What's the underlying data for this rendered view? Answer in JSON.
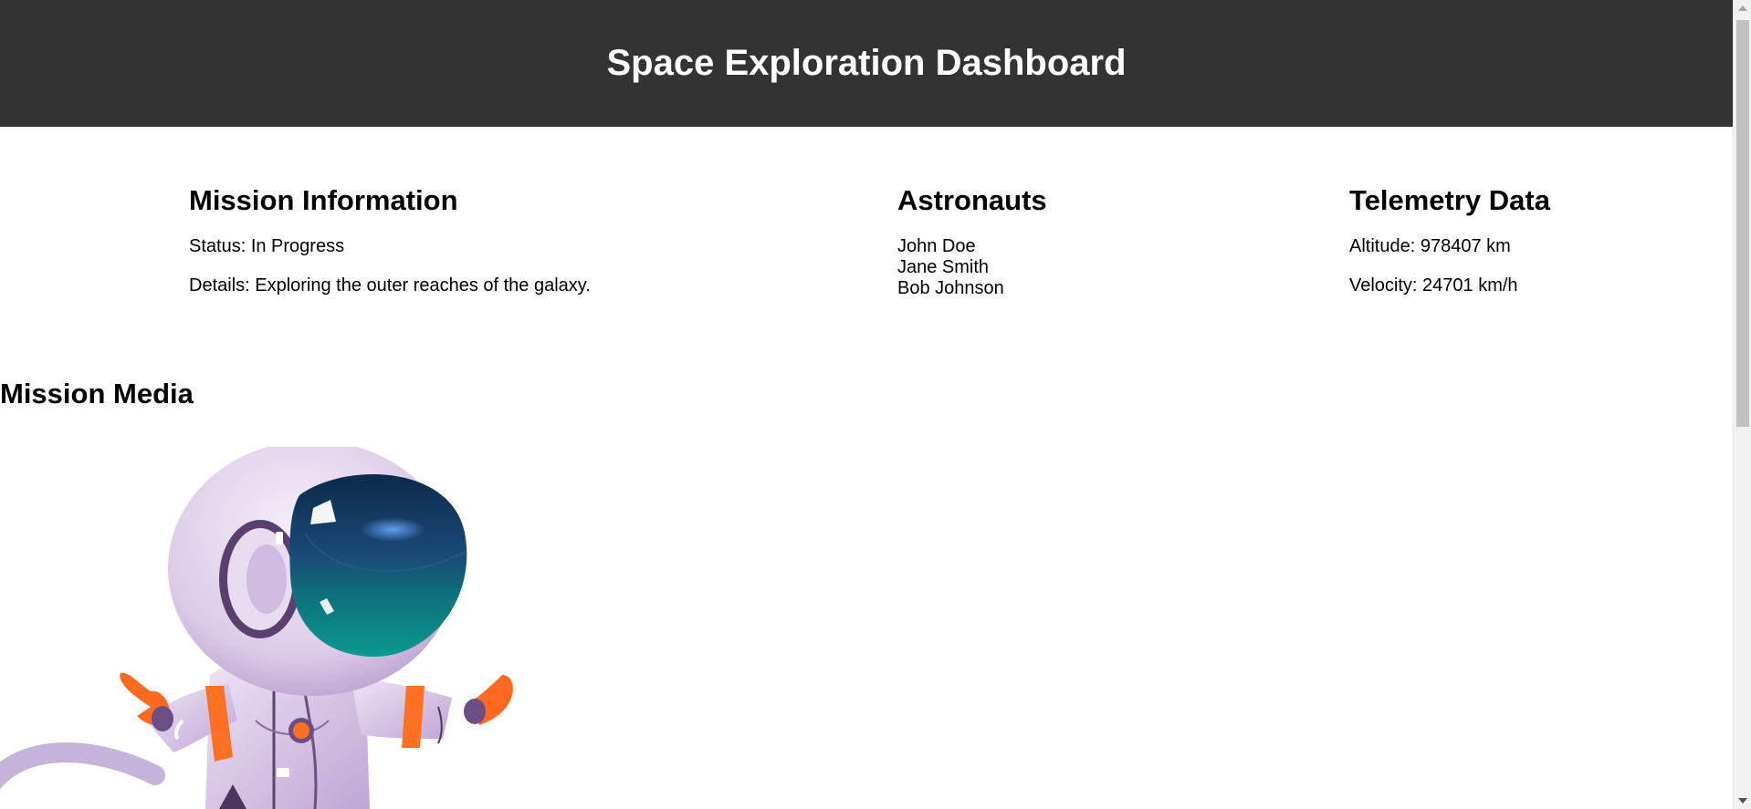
{
  "header": {
    "title": "Space Exploration Dashboard"
  },
  "mission_info": {
    "heading": "Mission Information",
    "status": "Status: In Progress",
    "details": "Details: Exploring the outer reaches of the galaxy."
  },
  "astronauts": {
    "heading": "Astronauts",
    "names": [
      "John Doe",
      "Jane Smith",
      "Bob Johnson"
    ]
  },
  "telemetry": {
    "heading": "Telemetry Data",
    "altitude": "Altitude: 978407 km",
    "velocity": "Velocity: 24701 km/h"
  },
  "media": {
    "heading": "Mission Media",
    "image_subject": "astronaut-illustration"
  },
  "colors": {
    "header_bg": "#333333",
    "suit_lavender": "#d9c8e6",
    "visor_teal": "#0f8f8a",
    "accent_orange": "#ff7022"
  }
}
